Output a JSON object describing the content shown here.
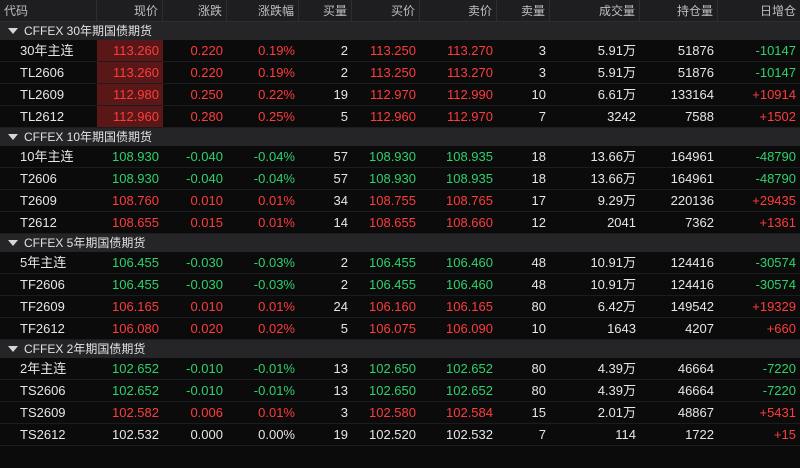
{
  "columns": [
    "代码",
    "现价",
    "涨跌",
    "涨跌幅",
    "买量",
    "买价",
    "卖价",
    "卖量",
    "成交量",
    "持仓量",
    "日增仓"
  ],
  "colors": {
    "up": "#ff3c3c",
    "down": "#2fd16b",
    "flat": "#e6e6e6",
    "highlight_bg": "#5a1717"
  },
  "groups": [
    {
      "name": "CFFEX 30年期国债期货",
      "rows": [
        {
          "code": "30年主连",
          "last": "113.260",
          "chg": "0.220",
          "pct": "0.19%",
          "bid_vol": "2",
          "bid": "113.250",
          "ask": "113.270",
          "ask_vol": "3",
          "volume": "5.91万",
          "oi": "51876",
          "oi_chg": "-10147",
          "dir": "up",
          "oi_dir": "down",
          "hl": true
        },
        {
          "code": "TL2606",
          "last": "113.260",
          "chg": "0.220",
          "pct": "0.19%",
          "bid_vol": "2",
          "bid": "113.250",
          "ask": "113.270",
          "ask_vol": "3",
          "volume": "5.91万",
          "oi": "51876",
          "oi_chg": "-10147",
          "dir": "up",
          "oi_dir": "down",
          "hl": true
        },
        {
          "code": "TL2609",
          "last": "112.980",
          "chg": "0.250",
          "pct": "0.22%",
          "bid_vol": "19",
          "bid": "112.970",
          "ask": "112.990",
          "ask_vol": "10",
          "volume": "6.61万",
          "oi": "133164",
          "oi_chg": "+10914",
          "dir": "up",
          "oi_dir": "up",
          "hl": true
        },
        {
          "code": "TL2612",
          "last": "112.960",
          "chg": "0.280",
          "pct": "0.25%",
          "bid_vol": "5",
          "bid": "112.960",
          "ask": "112.970",
          "ask_vol": "7",
          "volume": "3242",
          "oi": "7588",
          "oi_chg": "+1502",
          "dir": "up",
          "oi_dir": "up",
          "hl": true
        }
      ]
    },
    {
      "name": "CFFEX 10年期国债期货",
      "rows": [
        {
          "code": "10年主连",
          "last": "108.930",
          "chg": "-0.040",
          "pct": "-0.04%",
          "bid_vol": "57",
          "bid": "108.930",
          "ask": "108.935",
          "ask_vol": "18",
          "volume": "13.66万",
          "oi": "164961",
          "oi_chg": "-48790",
          "dir": "down",
          "oi_dir": "down",
          "hl": false
        },
        {
          "code": "T2606",
          "last": "108.930",
          "chg": "-0.040",
          "pct": "-0.04%",
          "bid_vol": "57",
          "bid": "108.930",
          "ask": "108.935",
          "ask_vol": "18",
          "volume": "13.66万",
          "oi": "164961",
          "oi_chg": "-48790",
          "dir": "down",
          "oi_dir": "down",
          "hl": false
        },
        {
          "code": "T2609",
          "last": "108.760",
          "chg": "0.010",
          "pct": "0.01%",
          "bid_vol": "34",
          "bid": "108.755",
          "ask": "108.765",
          "ask_vol": "17",
          "volume": "9.29万",
          "oi": "220136",
          "oi_chg": "+29435",
          "dir": "up",
          "oi_dir": "up",
          "hl": false
        },
        {
          "code": "T2612",
          "last": "108.655",
          "chg": "0.015",
          "pct": "0.01%",
          "bid_vol": "14",
          "bid": "108.655",
          "ask": "108.660",
          "ask_vol": "12",
          "volume": "2041",
          "oi": "7362",
          "oi_chg": "+1361",
          "dir": "up",
          "oi_dir": "up",
          "hl": false
        }
      ]
    },
    {
      "name": "CFFEX 5年期国债期货",
      "rows": [
        {
          "code": "5年主连",
          "last": "106.455",
          "chg": "-0.030",
          "pct": "-0.03%",
          "bid_vol": "2",
          "bid": "106.455",
          "ask": "106.460",
          "ask_vol": "48",
          "volume": "10.91万",
          "oi": "124416",
          "oi_chg": "-30574",
          "dir": "down",
          "oi_dir": "down",
          "hl": false
        },
        {
          "code": "TF2606",
          "last": "106.455",
          "chg": "-0.030",
          "pct": "-0.03%",
          "bid_vol": "2",
          "bid": "106.455",
          "ask": "106.460",
          "ask_vol": "48",
          "volume": "10.91万",
          "oi": "124416",
          "oi_chg": "-30574",
          "dir": "down",
          "oi_dir": "down",
          "hl": false
        },
        {
          "code": "TF2609",
          "last": "106.165",
          "chg": "0.010",
          "pct": "0.01%",
          "bid_vol": "24",
          "bid": "106.160",
          "ask": "106.165",
          "ask_vol": "80",
          "volume": "6.42万",
          "oi": "149542",
          "oi_chg": "+19329",
          "dir": "up",
          "oi_dir": "up",
          "hl": false
        },
        {
          "code": "TF2612",
          "last": "106.080",
          "chg": "0.020",
          "pct": "0.02%",
          "bid_vol": "5",
          "bid": "106.075",
          "ask": "106.090",
          "ask_vol": "10",
          "volume": "1643",
          "oi": "4207",
          "oi_chg": "+660",
          "dir": "up",
          "oi_dir": "up",
          "hl": false
        }
      ]
    },
    {
      "name": "CFFEX 2年期国债期货",
      "rows": [
        {
          "code": "2年主连",
          "last": "102.652",
          "chg": "-0.010",
          "pct": "-0.01%",
          "bid_vol": "13",
          "bid": "102.650",
          "ask": "102.652",
          "ask_vol": "80",
          "volume": "4.39万",
          "oi": "46664",
          "oi_chg": "-7220",
          "dir": "down",
          "oi_dir": "down",
          "hl": false
        },
        {
          "code": "TS2606",
          "last": "102.652",
          "chg": "-0.010",
          "pct": "-0.01%",
          "bid_vol": "13",
          "bid": "102.650",
          "ask": "102.652",
          "ask_vol": "80",
          "volume": "4.39万",
          "oi": "46664",
          "oi_chg": "-7220",
          "dir": "down",
          "oi_dir": "down",
          "hl": false
        },
        {
          "code": "TS2609",
          "last": "102.582",
          "chg": "0.006",
          "pct": "0.01%",
          "bid_vol": "3",
          "bid": "102.580",
          "ask": "102.584",
          "ask_vol": "15",
          "volume": "2.01万",
          "oi": "48867",
          "oi_chg": "+5431",
          "dir": "up",
          "oi_dir": "up",
          "hl": false
        },
        {
          "code": "TS2612",
          "last": "102.532",
          "chg": "0.000",
          "pct": "0.00%",
          "bid_vol": "19",
          "bid": "102.520",
          "ask": "102.532",
          "ask_vol": "7",
          "volume": "114",
          "oi": "1722",
          "oi_chg": "+15",
          "dir": "flat",
          "oi_dir": "up",
          "hl": false
        }
      ]
    }
  ]
}
